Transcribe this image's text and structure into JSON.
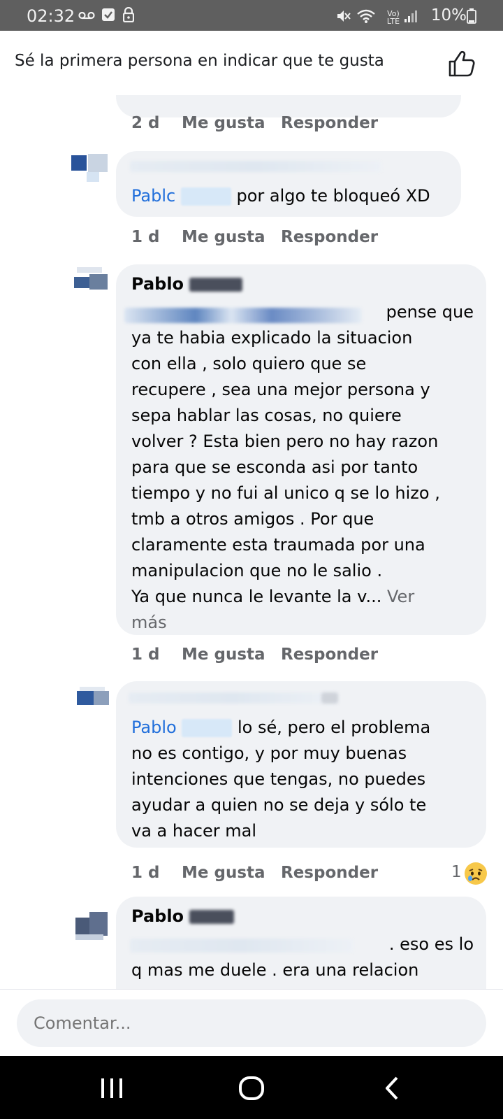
{
  "status_bar": {
    "time": "02:32",
    "battery": "10%",
    "network_top": "Vo)",
    "network_bottom": "LTE",
    "icons": [
      "voicemail-icon",
      "checkbox-icon",
      "lock-icon",
      "mute-icon",
      "wifi-icon",
      "signal-icon",
      "battery-icon"
    ]
  },
  "header": {
    "text": "Sé la primera persona en indicar que te gusta",
    "icon": "thumbs-up-icon"
  },
  "comments": [
    {
      "time": "2 d",
      "like_label": "Me gusta",
      "reply_label": "Responder"
    },
    {
      "mention": "Pablc",
      "text": "por algo te bloqueó XD",
      "time": "1 d",
      "like_label": "Me gusta",
      "reply_label": "Responder"
    },
    {
      "author": "Pablo",
      "lines": [
        "pense que",
        "ya te habia explicado la situacion",
        "con ella , solo quiero que se",
        "recupere , sea una mejor persona y",
        "sepa hablar las cosas, no quiere",
        "volver ? Esta bien pero no hay razon",
        "para que se esconda asi por tanto",
        "tiempo y no fui al unico q se lo hizo ,",
        "tmb a otros amigos . Por que",
        "claramente esta traumada por una",
        "manipulacion que no le salio .",
        "Ya que nunca le levante la v..."
      ],
      "see_more": "Ver más",
      "time": "1 d",
      "like_label": "Me gusta",
      "reply_label": "Responder"
    },
    {
      "mention": "Pablo",
      "lines": [
        "lo sé, pero el problema",
        "no es contigo, y por muy buenas",
        "intenciones que tengas, no puedes",
        "ayudar a quien no se deja y sólo te",
        "va a hacer mal"
      ],
      "time": "1 d",
      "like_label": "Me gusta",
      "reply_label": "Responder",
      "reaction_count": "1",
      "reaction_icon": "sad-face-icon"
    },
    {
      "author": "Pablo",
      "lines": [
        ". eso es lo",
        "q mas me duele . era una relacion"
      ]
    }
  ],
  "composer": {
    "placeholder": "Comentar..."
  },
  "nav": {
    "icons": [
      "recent-apps-icon",
      "home-icon",
      "back-icon"
    ]
  }
}
